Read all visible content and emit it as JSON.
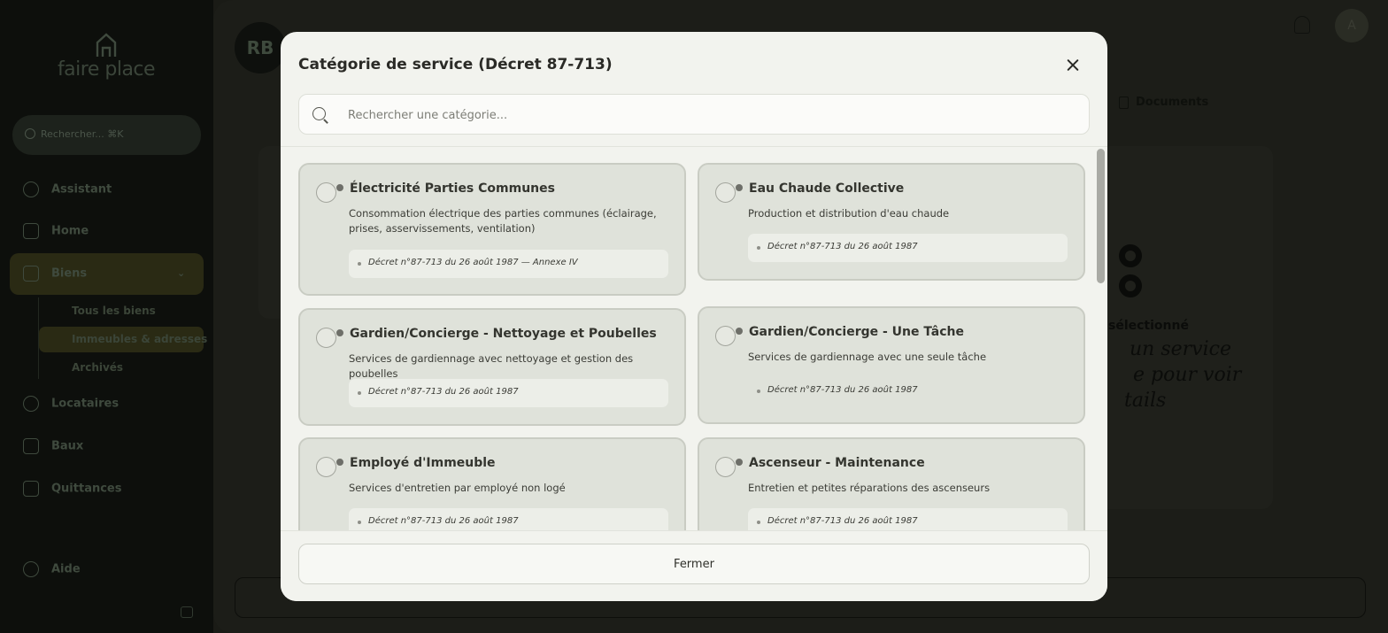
{
  "app": {
    "logo_text": "faire place",
    "sidebar_search": "Rechercher... ⌘K",
    "nav": [
      "Assistant",
      "Home",
      "Biens",
      "Locataires",
      "Baux",
      "Quittances",
      "Aide"
    ],
    "subnav": [
      "Tous les biens",
      "Immeubles & adresses",
      "Archivés"
    ],
    "avatar_initials": "RB",
    "user_initial": "A",
    "documents_tab": "Documents",
    "empty_state_title": "sélectionné",
    "empty_state_hint_lines": [
      "un service",
      "e pour voir",
      "tails"
    ]
  },
  "modal": {
    "title": "Catégorie de service (Décret 87-713)",
    "search_placeholder": "Rechercher une catégorie...",
    "footer_button": "Fermer",
    "categories": [
      {
        "title": "Électricité Parties Communes",
        "description": "Consommation électrique des parties communes (éclairage, prises, asservissements, ventilation)",
        "reference": "Décret n°87-713 du 26 août 1987 — Annexe IV"
      },
      {
        "title": "Eau Chaude Collective",
        "description": "Production et distribution d'eau chaude",
        "reference": "Décret n°87-713 du 26 août 1987"
      },
      {
        "title": "Gardien/Concierge - Nettoyage et Poubelles",
        "description": "Services de gardiennage avec nettoyage et gestion des poubelles",
        "reference": "Décret n°87-713 du 26 août 1987"
      },
      {
        "title": "Gardien/Concierge - Une Tâche",
        "description": "Services de gardiennage avec une seule tâche",
        "reference": "Décret n°87-713 du 26 août 1987"
      },
      {
        "title": "Employé d'Immeuble",
        "description": "Services d'entretien par employé non logé",
        "reference": "Décret n°87-713 du 26 août 1987"
      },
      {
        "title": "Ascenseur - Maintenance",
        "description": "Entretien et petites réparations des ascenseurs",
        "reference": "Décret n°87-713 du 26 août 1987"
      }
    ]
  }
}
